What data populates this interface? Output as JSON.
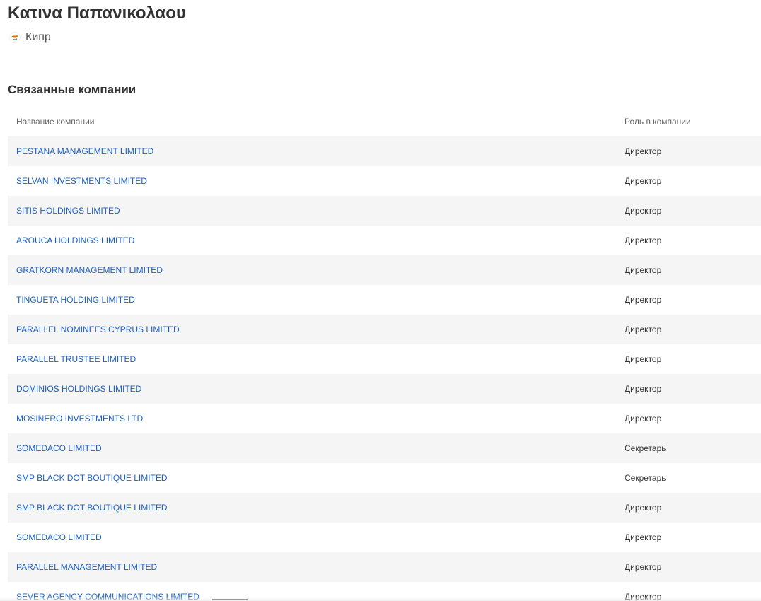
{
  "person": {
    "name": "Κατινα Παπανικολαου",
    "country": "Кипр",
    "flag_icon": "cyprus-flag-icon"
  },
  "related": {
    "title": "Связанные компании",
    "columns": {
      "name": "Название компании",
      "role": "Роль в компании"
    },
    "rows": [
      {
        "company": "PESTANA MANAGEMENT LIMITED",
        "role": "Директор"
      },
      {
        "company": "SELVAN INVESTMENTS LIMITED",
        "role": "Директор"
      },
      {
        "company": "SITIS HOLDINGS LIMITED",
        "role": "Директор"
      },
      {
        "company": "AROUCA HOLDINGS LIMITED",
        "role": "Директор"
      },
      {
        "company": "GRATKORN MANAGEMENT LIMITED",
        "role": "Директор"
      },
      {
        "company": "TINGUETA HOLDING LIMITED",
        "role": "Директор"
      },
      {
        "company": "PARALLEL NOMINEES CYPRUS LIMITED",
        "role": "Директор"
      },
      {
        "company": "PARALLEL TRUSTEE LIMITED",
        "role": "Директор"
      },
      {
        "company": "DOMINIOS HOLDINGS LIMITED",
        "role": "Директор"
      },
      {
        "company": "MOSINERO INVESTMENTS LTD",
        "role": "Директор"
      },
      {
        "company": "SOMEDACO LIMITED",
        "role": "Секретарь"
      },
      {
        "company": "SMP BLACK DOT BOUTIQUE LIMITED",
        "role": "Секретарь"
      },
      {
        "company": "SMP BLACK DOT BOUTIQUE LIMITED",
        "role": "Директор"
      },
      {
        "company": "SOMEDACO LIMITED",
        "role": "Директор"
      },
      {
        "company": "PARALLEL MANAGEMENT LIMITED",
        "role": "Директор"
      },
      {
        "company": "SEVER AGENCY COMMUNICATIONS LIMITED",
        "role": "Директор"
      }
    ]
  },
  "colors": {
    "link": "#1a5fc8",
    "row_stripe": "#f5f5f5",
    "text": "#333333"
  }
}
